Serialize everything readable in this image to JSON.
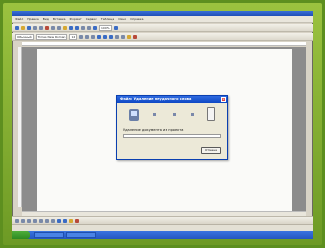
{
  "menubar": {
    "items": [
      "Файл",
      "Правка",
      "Вид",
      "Вставка",
      "Формат",
      "Сервис",
      "Таблица",
      "Окно",
      "Справка"
    ]
  },
  "toolbar": {
    "style_value": "Обычный",
    "font_value": "Times New Roman",
    "size_value": "12",
    "zoom_value": "100%"
  },
  "dialog": {
    "title": "Файл: Удаление неудачного слова",
    "status": "Удаление документа из проекта",
    "progress": 0.0,
    "cancel_label": "Отмена"
  }
}
